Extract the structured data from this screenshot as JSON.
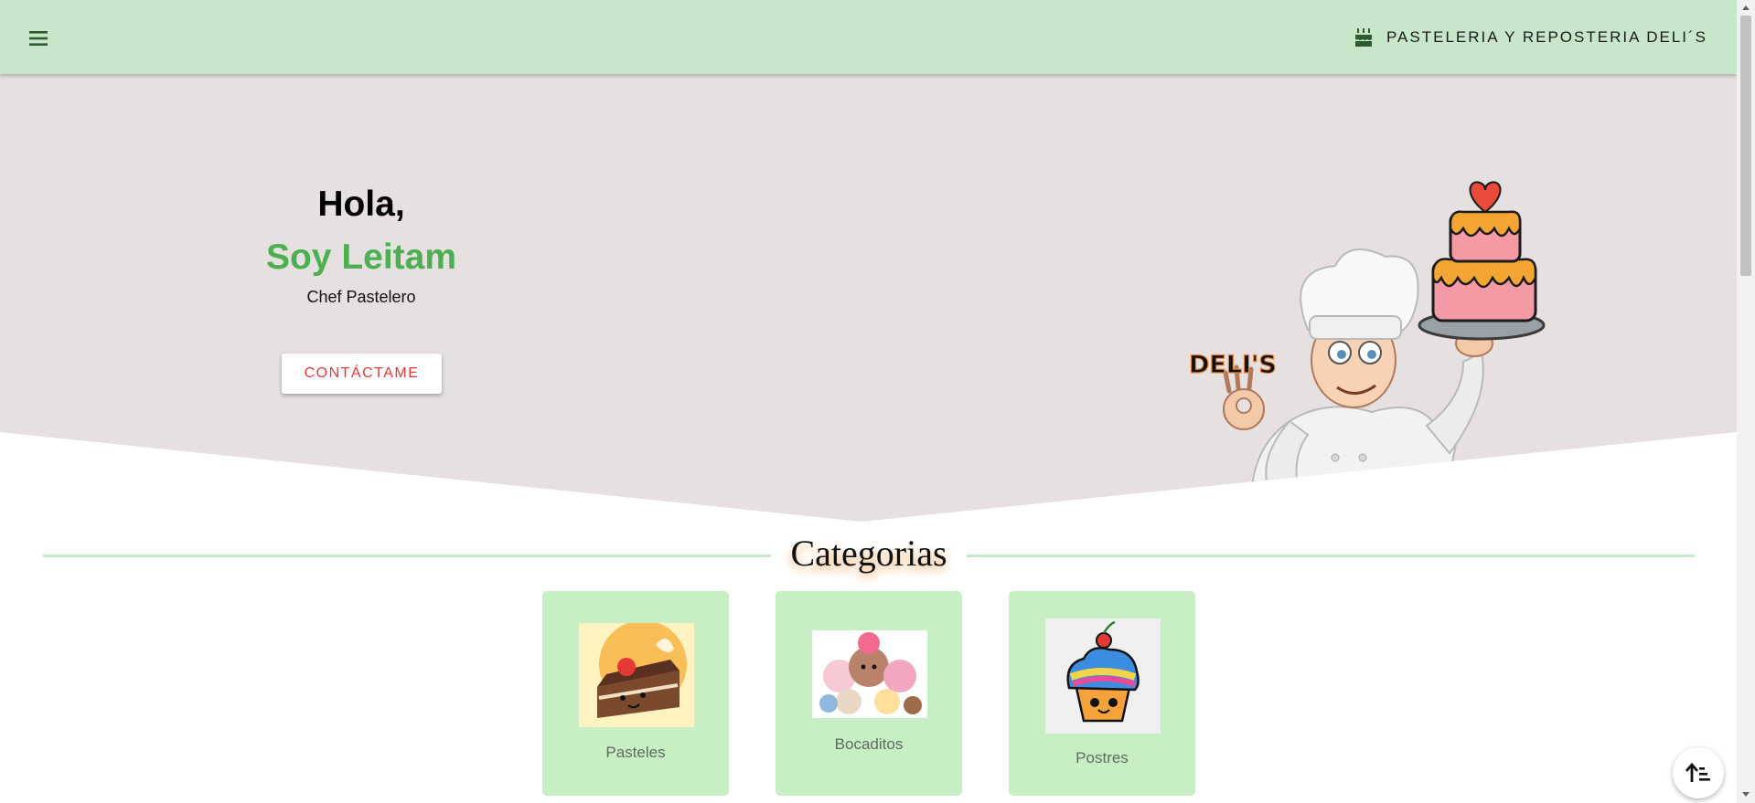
{
  "header": {
    "menu_icon": "hamburger-menu-icon",
    "brand_icon": "cake-icon",
    "brand_title": "PASTELERIA Y REPOSTERIA DELI´S",
    "background": "#c8e6c9"
  },
  "hero": {
    "greeting": "Hola,",
    "name": "Soy Leitam",
    "role": "Chef Pastelero",
    "cta_label": "CONTÁCTAME",
    "logo_text": "DELI'S",
    "scroll_icon": "sort-down-icon",
    "colors": {
      "background": "#e6e0e0",
      "name": "#4caf50",
      "cta_text": "#e53935"
    }
  },
  "categories": {
    "title": "Categorias",
    "items": [
      {
        "label": "Pasteles",
        "image": "cake-slice-image"
      },
      {
        "label": "Bocaditos",
        "image": "snacks-image"
      },
      {
        "label": "Postres",
        "image": "cupcake-image"
      }
    ],
    "card_color": "#c8efc4"
  },
  "fab": {
    "icon": "sort-up-icon"
  }
}
